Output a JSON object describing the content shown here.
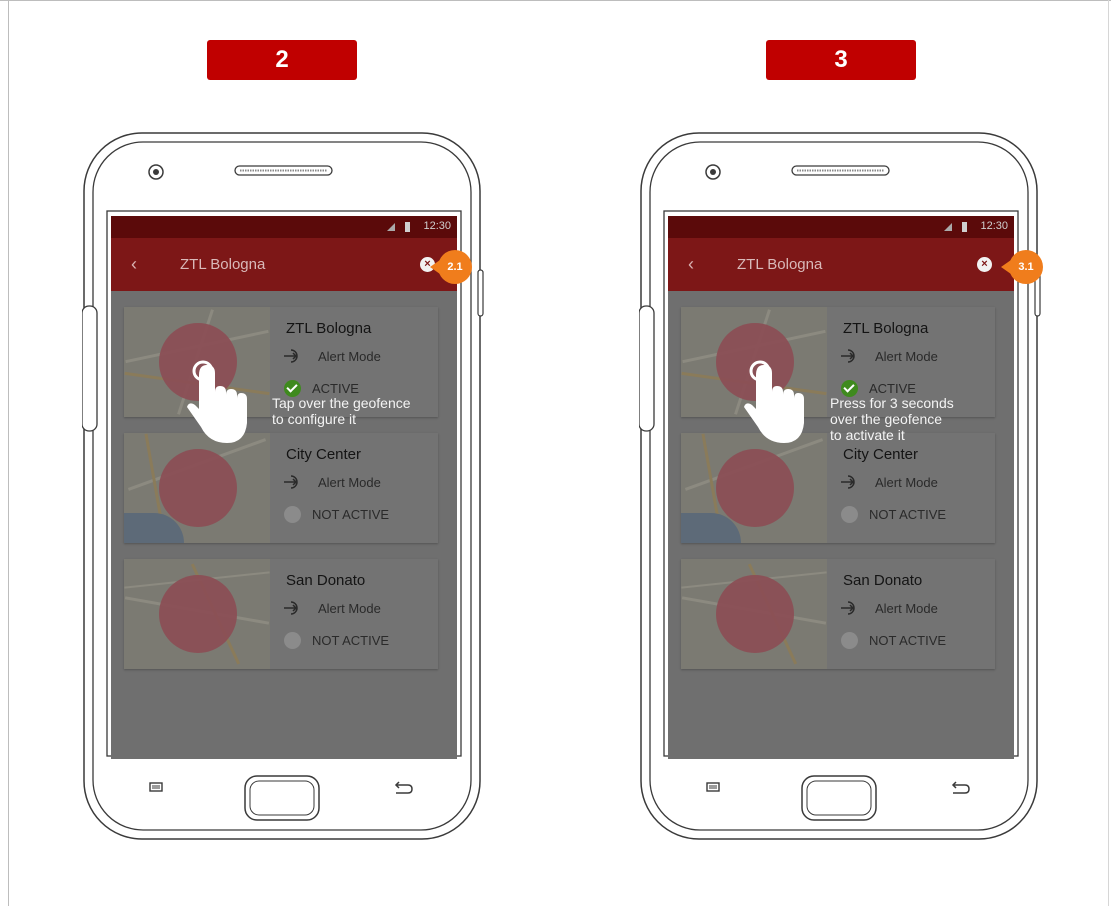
{
  "steps": [
    {
      "badge": "2",
      "status_time": "12:30",
      "app_title": "ZTL Bologna",
      "back_glyph": "‹",
      "close_glyph": "×",
      "callout": "2.1",
      "hint_text": "Tap over the geofence\nto configure it",
      "cards": [
        {
          "name": "ZTL Bologna",
          "mode": "Alert Mode",
          "status": "ACTIVE"
        },
        {
          "name": "City Center",
          "mode": "Alert Mode",
          "status": "NOT ACTIVE"
        },
        {
          "name": "San Donato",
          "mode": "Alert Mode",
          "status": "NOT ACTIVE"
        }
      ]
    },
    {
      "badge": "3",
      "status_time": "12:30",
      "app_title": "ZTL Bologna",
      "back_glyph": "‹",
      "close_glyph": "×",
      "callout": "3.1",
      "hint_text": "Press for 3 seconds\nover the geofence\nto activate it",
      "cards": [
        {
          "name": "ZTL Bologna",
          "mode": "Alert Mode",
          "status": "ACTIVE"
        },
        {
          "name": "City Center",
          "mode": "Alert Mode",
          "status": "NOT ACTIVE"
        },
        {
          "name": "San Donato",
          "mode": "Alert Mode",
          "status": "NOT ACTIVE"
        }
      ]
    }
  ],
  "icons": {
    "geofence_entry": "enter-arrow-icon",
    "active_status": "check-circle-icon",
    "inactive_status": "grey-circle-icon",
    "gesture": "pointing-hand-icon"
  },
  "colors": {
    "step_badge": "#c00000",
    "app_bar": "#7d1717",
    "status_bar": "#5b0a0a",
    "callout": "#f07d1c",
    "active_check": "#3f8a1e",
    "geofence_fill": "#8b4f55"
  }
}
